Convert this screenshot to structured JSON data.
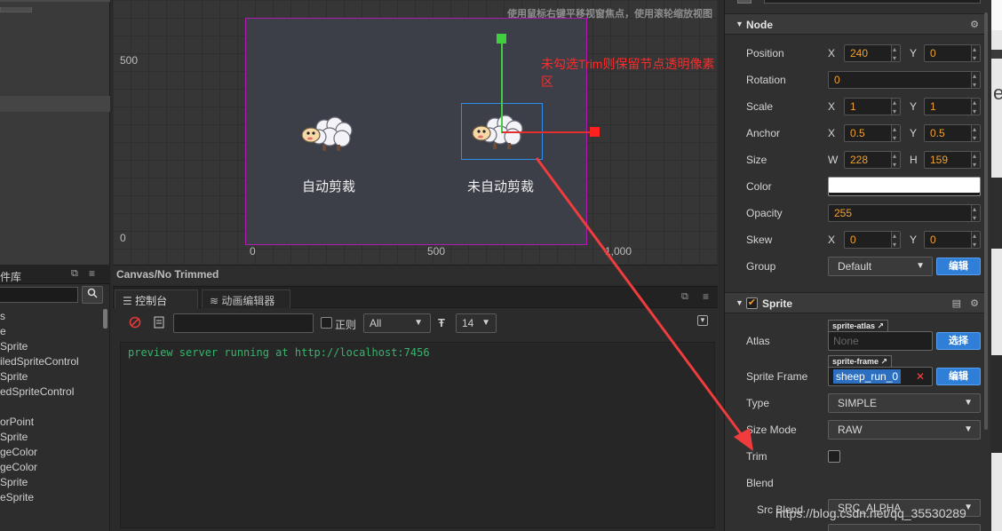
{
  "scene": {
    "hint": "使用鼠标右键平移视窗焦点，使用滚轮缩放视图",
    "annotation": "未勾选Trim则保留节点透明像素区",
    "axis_y_500": "500",
    "axis_y_0": "0",
    "axis_x_0": "0",
    "axis_x_500": "500",
    "axis_x_1000": "1,000",
    "sprite_auto_trim_caption": "自动剪裁",
    "sprite_no_trim_caption": "未自动剪裁",
    "status": "Canvas/No Trimmed"
  },
  "assets": {
    "title": "件库",
    "items": [
      "s",
      "e",
      "Sprite",
      "iledSpriteControl",
      "Sprite",
      "edSpriteControl",
      "",
      "orPoint",
      "Sprite",
      "geColor",
      "geColor",
      "Sprite",
      "eSprite"
    ]
  },
  "console": {
    "tab_console": "控制台",
    "tab_animation": "动画编辑器",
    "regex_label": "正则",
    "level_select": "All",
    "font_size_select": "14",
    "output_line": "preview server running at http://localhost:7456"
  },
  "inspector": {
    "node": {
      "title": "Node",
      "position_label": "Position",
      "position_x": "240",
      "position_y": "0",
      "rotation_label": "Rotation",
      "rotation": "0",
      "scale_label": "Scale",
      "scale_x": "1",
      "scale_y": "1",
      "anchor_label": "Anchor",
      "anchor_x": "0.5",
      "anchor_y": "0.5",
      "size_label": "Size",
      "size_w": "228",
      "size_h": "159",
      "color_label": "Color",
      "color_value": "#ffffff",
      "opacity_label": "Opacity",
      "opacity": "255",
      "skew_label": "Skew",
      "skew_x": "0",
      "skew_y": "0",
      "group_label": "Group",
      "group": "Default",
      "group_edit": "编辑",
      "axis_x": "X",
      "axis_y": "Y",
      "axis_w": "W",
      "axis_h": "H"
    },
    "sprite": {
      "title": "Sprite",
      "atlas_label": "Atlas",
      "atlas_tag": "sprite-atlas",
      "atlas_value": "None",
      "atlas_select": "选择",
      "frame_label": "Sprite Frame",
      "frame_tag": "sprite-frame",
      "frame_value": "sheep_run_0",
      "frame_edit": "编辑",
      "type_label": "Type",
      "type": "SIMPLE",
      "size_mode_label": "Size Mode",
      "size_mode": "RAW",
      "trim_label": "Trim",
      "trim_checked": false,
      "blend_label": "Blend",
      "src_blend_label": "Src Blend",
      "src_blend": "SRC_ALPHA"
    }
  },
  "right_strip_text": "e",
  "watermark": "https://blog.csdn.net/qq_35530289",
  "colors": {
    "annotation": "#ff2a2a",
    "canvas_border": "#b01ab0",
    "selection": "#2f8fe8",
    "gizmo_y": "#3fcf3f",
    "gizmo_x": "#e62e2e",
    "console_text": "#37b46c",
    "button_blue": "#2f7ed8",
    "number_text": "#f0a030"
  }
}
